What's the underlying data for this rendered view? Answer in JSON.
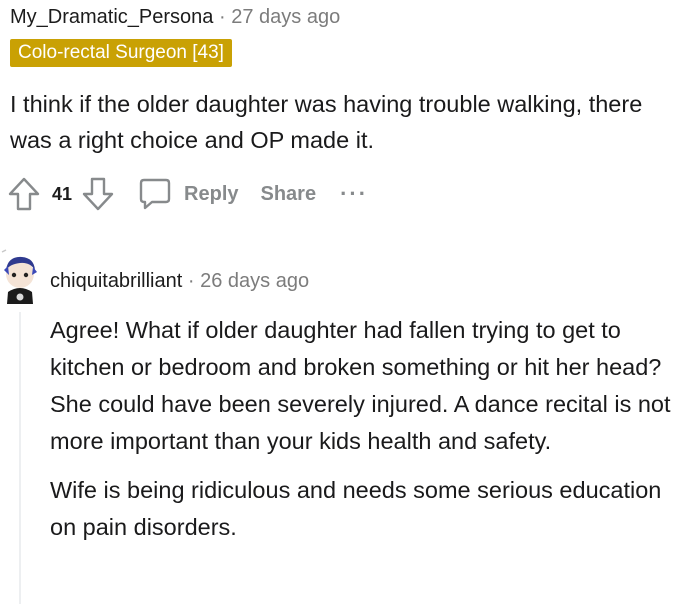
{
  "comment1": {
    "username": "My_Dramatic_Persona",
    "separator": "·",
    "time": "27 days ago",
    "flair": "Colo-rectal Surgeon [43]",
    "body": "I think if the older daughter was having trouble walking, there was a right choice and OP made it.",
    "votes": "41",
    "reply_label": "Reply",
    "share_label": "Share",
    "more_label": "···"
  },
  "comment2": {
    "username": "chiquitabrilliant",
    "separator": "·",
    "time": "26 days ago",
    "paragraphs": [
      "Agree! What if older daughter had fallen trying to get to kitchen or bedroom and broken something or hit her head? She could have been severely injured. A dance recital is not more important than your kids health and safety.",
      "Wife is being ridiculous and needs some serious education on pain disorders."
    ]
  },
  "colors": {
    "flair_bg": "#c9a104",
    "meta_text": "#7c7c7c",
    "action_text": "#878a8c"
  }
}
